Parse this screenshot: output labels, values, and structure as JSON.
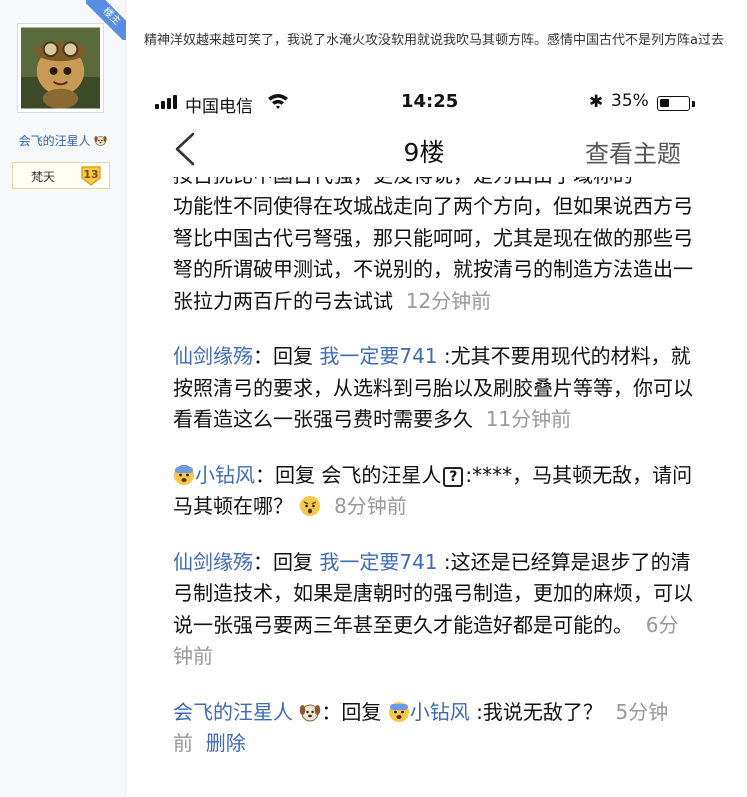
{
  "author_panel": {
    "badge": "楼主",
    "name": "会飞的汪星人",
    "level_name": "梵天",
    "level": "13"
  },
  "post": {
    "text": "精神洋奴越来越可笑了，我说了水淹火攻没软用就说我吹马其顿方阵。感情中国古代不是列方阵a过去"
  },
  "phone": {
    "status_bar": {
      "carrier": "中国电信",
      "time": "14:25",
      "battery_pct": "35%",
      "battery_level": 0.35
    },
    "nav": {
      "title": "9楼",
      "right_action": "查看主题"
    },
    "thread": {
      "cut_line": "按古扰比中国古代强，更没得说，是为由由于域称的",
      "first_lines": "功能性不同使得在攻城战走向了两个方向，但如果说西方弓弩比中国古代弓弩强，那只能呵呵，尤其是现在做的那些弓弩的所谓破甲测试，不说别的，就按清弓的制造方法造出一张拉力两百斤的弓去试试",
      "first_time": "12分钟前",
      "comments": [
        {
          "user": "仙剑缘殇",
          "sep": "：",
          "reply_word": "回复",
          "quote_user": "我一定要741",
          "text": ":尤其不要用现代的材料，就按照清弓的要求，从选料到弓胎以及刷胶叠片等等，你可以看看造这么一张强弓费时需要多久",
          "time": "11分钟前"
        },
        {
          "user": "小钻风",
          "sep": "：",
          "reply_word": "回复",
          "quote_user": "会飞的汪星人",
          "text": ":****，马其顿无敌，请问马其顿在哪？",
          "time": "8分钟前"
        },
        {
          "user": "仙剑缘殇",
          "sep": "：",
          "reply_word": "回复",
          "quote_user": "我一定要741",
          "text": ":这还是已经算是退步了的清弓制造技术，如果是唐朝时的强弓制造，更加的麻烦，可以说一张强弓要两三年甚至更久才能造好都是可能的。",
          "time": "6分钟前"
        },
        {
          "user": "会飞的汪星人",
          "sep": "：",
          "reply_word": "回复",
          "quote_user": "小钻风",
          "text": ":我说无敌了？",
          "time": "5分钟前",
          "delete": "删除"
        }
      ],
      "qbox_char": "?"
    }
  },
  "colors": {
    "link_blue": "#3f6ab8",
    "badge_blue": "#5a8de0",
    "time_gray": "#999999"
  }
}
